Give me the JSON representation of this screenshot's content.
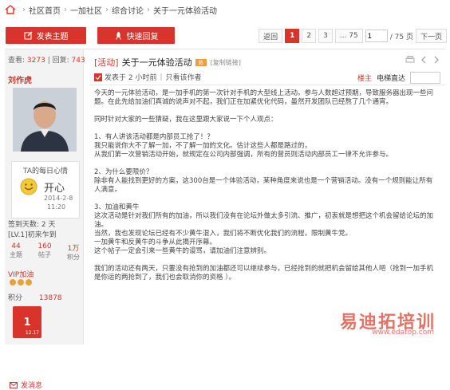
{
  "breadcrumb": {
    "items": [
      "社区首页",
      "一加社区",
      "综合讨论",
      "关于一元体验活动"
    ]
  },
  "toolbar": {
    "new_topic": "发表主题",
    "quick_reply": "快速回复"
  },
  "pager": {
    "prev": "返回",
    "pages": [
      "1",
      "2",
      "3",
      "... 75"
    ],
    "current": "1",
    "input_value": "1",
    "total": "/ 75 页",
    "next": "下一页"
  },
  "author": {
    "views_label": "查看:",
    "views": "3273",
    "replies_label": "回复:",
    "replies": "743",
    "name": "刘作虎",
    "mood_title": "TA的每日心情",
    "mood": "开心",
    "mood_date": "2014-2-8",
    "mood_time": "11:20",
    "signin": "签到天数: 2 天",
    "level": "[LV.1]初来乍到",
    "count_values": [
      "44",
      "160",
      "1万"
    ],
    "count_labels": [
      "主题",
      "帖子",
      "积分"
    ],
    "vip_label": "VIP加油",
    "points_label": "积分",
    "points_value": "13878",
    "medal_text": "1",
    "medal_sub": "12.17",
    "pm": "发消息"
  },
  "post": {
    "tag": "[活动]",
    "title": "关于一元体验活动",
    "hot_badge": "热",
    "copy_link": "[复制链接]",
    "time_prefix": "发表于 2 小时前",
    "only_author": "只看该作者",
    "order_label": "楼主",
    "order_value": "电梯直达",
    "paragraphs": [
      "今天的一元体验活动，是一加手机的第一次针对手机的大型线上活动。参与人数超过预期，导致服务器出现一些问题。在此先给加油们真诚的说声对不起，我们正在加紧优化代码，虽然开发团队已经熬了几个通宵。",
      "同时针对大家的一些猜疑，我在这里跟大家说一下个人观点：",
      "1、有人讲该活动都是内部员工抢了！？",
      "我只能说你大不了解一加，不了解一加的文化。估计这些人都是路过的，",
      "从我们第一次营销活动开始，就规定在公司内部强调，所有的营员则活动内部员工一律不允许参与。",
      "2、为什么要限价？",
      "除非有人能找到更好的方案，这300台是一个体验活动，某种角度来说也是一个营销活动。没有一个规则能让所有人满意。",
      "3、加油和黄牛",
      "这次活动是针对我们所有的加油，所以我们没有在论坛外做太多引流、推广，初衷就是想把这个机会留给论坛的加油。",
      "当然，我也发现论坛已经有不少黄牛混入，我们将不断优化我们的流程，限制黄牛党。",
      "一加黄牛和反黄牛的斗争从此揭开序幕。",
      "这个帖子一定会引来一些黄牛的谩骂，请加油们注意辨别。",
      "我们的活动还有两天，只要没有抢到的加油都还可以继续参与，已经抢到的就把机会留给其他人吧（抢到一加手机是你运的两抢到了，我们也会取消你的资格 ）。"
    ]
  },
  "watermark": {
    "title": "易迪拓培训",
    "url": "www.edatop.com"
  },
  "colors": {
    "accent": "#d9342b",
    "sidebar": "#f3f3f3"
  }
}
